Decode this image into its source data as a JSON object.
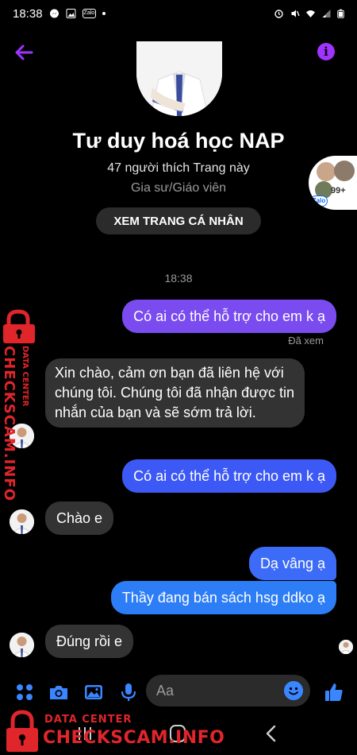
{
  "status_bar": {
    "time": "18:38"
  },
  "page": {
    "name": "Tư duy hoá học NAP",
    "likes": "47 người thích Trang này",
    "category": "Gia sư/Giáo viên",
    "view_button": "XEM TRANG CÁ NHÂN"
  },
  "chat_head": {
    "count": "99+",
    "badge": "Zalo"
  },
  "conversation": {
    "timestamp": "18:38",
    "messages": [
      {
        "from": "me",
        "text": "Có ai có thể hỗ trợ cho em k ạ"
      },
      {
        "from": "page",
        "text": "Xin chào, cảm ơn bạn đã liên hệ với chúng tôi. Chúng tôi đã nhận được tin nhắn của bạn và sẽ sớm trả lời."
      },
      {
        "from": "me",
        "text": "Có ai có thể hỗ trợ cho em k ạ"
      },
      {
        "from": "page",
        "text": "Chào e"
      },
      {
        "from": "me",
        "text": "Dạ vâng ạ"
      },
      {
        "from": "me",
        "text": "Thầy đang bán sách hsg ddko ạ"
      },
      {
        "from": "page",
        "text": "Đúng rồi e"
      }
    ],
    "seen_label": "Đã xem"
  },
  "composer": {
    "placeholder": "Aa"
  },
  "watermark": {
    "line1": "DATA CENTER",
    "line2": "CHECKSCAM.INFO"
  },
  "colors": {
    "accent": "#a033ff",
    "outgoing_1": "#7a4cf0",
    "outgoing_2": "#3d59f5",
    "outgoing_3": "#2d7df6",
    "incoming": "#333333",
    "composer_icon": "#3a86ff",
    "watermark": "#e0252b"
  },
  "icons": [
    "back-arrow",
    "info",
    "apps",
    "camera",
    "gallery",
    "microphone",
    "emoji",
    "thumbs-up",
    "lock"
  ]
}
